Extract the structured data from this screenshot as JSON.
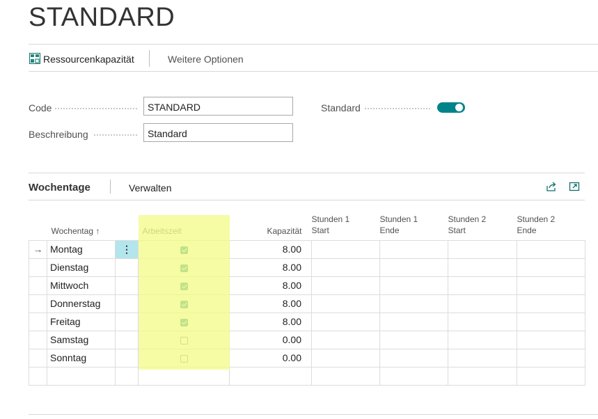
{
  "page": {
    "title": "STANDARD"
  },
  "actionbar": {
    "items": [
      {
        "label": "Ressourcenkapazität",
        "icon": "resource-capacity-icon"
      },
      {
        "label": "Weitere Optionen"
      }
    ]
  },
  "general": {
    "code_label": "Code",
    "code_value": "STANDARD",
    "description_label": "Beschreibung",
    "description_value": "Standard",
    "standard_label": "Standard",
    "standard_toggle": true
  },
  "lines": {
    "section_title": "Wochentage",
    "manage_label": "Verwalten",
    "columns": {
      "weekday": "Wochentag ↑",
      "working": "Arbeitszeit",
      "capacity": "Kapazität",
      "h1_start": [
        "Stunden 1",
        "Start"
      ],
      "h1_end": [
        "Stunden 1",
        "Ende"
      ],
      "h2_start": [
        "Stunden 2",
        "Start"
      ],
      "h2_end": [
        "Stunden 2",
        "Ende"
      ]
    },
    "rows": [
      {
        "day": "Montag",
        "working": true,
        "capacity": "8.00",
        "selected": true
      },
      {
        "day": "Dienstag",
        "working": true,
        "capacity": "8.00"
      },
      {
        "day": "Mittwoch",
        "working": true,
        "capacity": "8.00"
      },
      {
        "day": "Donnerstag",
        "working": true,
        "capacity": "8.00"
      },
      {
        "day": "Freitag",
        "working": true,
        "capacity": "8.00"
      },
      {
        "day": "Samstag",
        "working": false,
        "capacity": "0.00"
      },
      {
        "day": "Sonntag",
        "working": false,
        "capacity": "0.00"
      }
    ]
  },
  "colors": {
    "accent": "#008489",
    "highlight": "#f3fb8a",
    "selected_cell": "#b3e5ec"
  }
}
